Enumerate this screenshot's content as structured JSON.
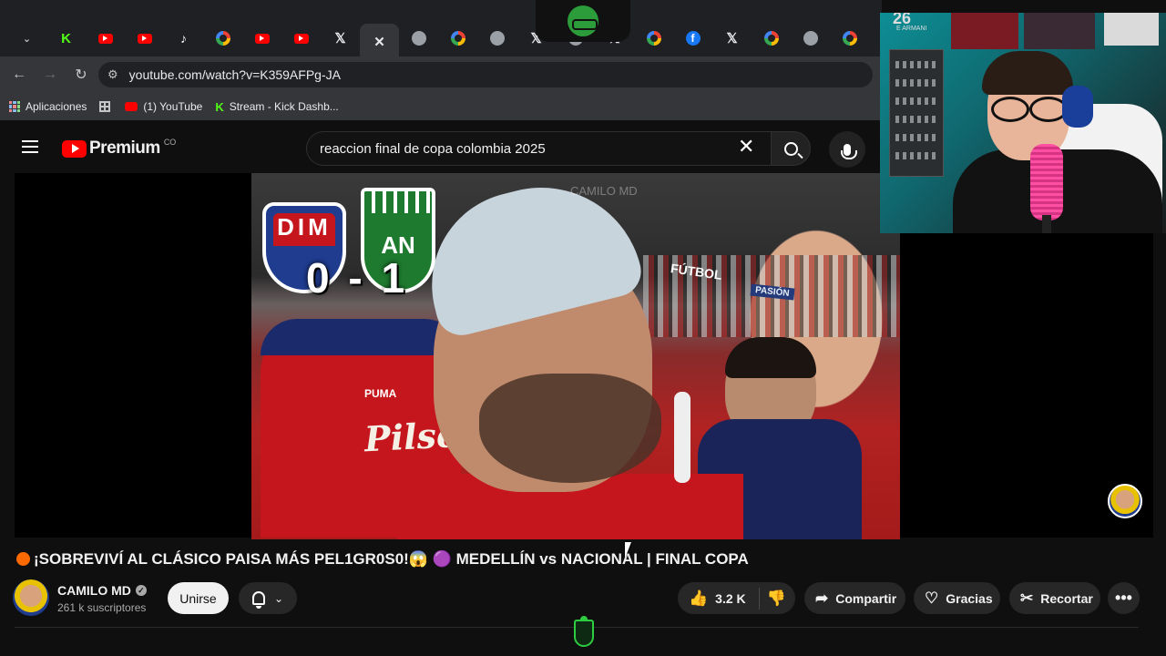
{
  "browser": {
    "tabs": [
      {
        "icon": "kick-icon",
        "glyph": "K",
        "cls": "k"
      },
      {
        "icon": "youtube-icon",
        "glyph": "",
        "cls": "yt"
      },
      {
        "icon": "youtube-icon",
        "glyph": "",
        "cls": "yt"
      },
      {
        "icon": "tiktok-icon",
        "glyph": "♪",
        "cls": "tt"
      },
      {
        "icon": "google-icon",
        "glyph": "",
        "cls": "g"
      },
      {
        "icon": "youtube-icon",
        "glyph": "",
        "cls": "yt"
      },
      {
        "icon": "youtube-icon",
        "glyph": "",
        "cls": "yt"
      },
      {
        "icon": "x-icon",
        "glyph": "𝕏",
        "cls": "x"
      },
      {
        "icon": "close-icon",
        "glyph": "✕",
        "cls": "x",
        "active": true
      },
      {
        "icon": "globe-icon",
        "glyph": "",
        "cls": "gl"
      },
      {
        "icon": "google-icon",
        "glyph": "",
        "cls": "g"
      },
      {
        "icon": "globe-icon",
        "glyph": "",
        "cls": "gl"
      },
      {
        "icon": "x-icon",
        "glyph": "𝕏",
        "cls": "x"
      },
      {
        "icon": "globe-icon",
        "glyph": "",
        "cls": "gl"
      },
      {
        "icon": "x-icon",
        "glyph": "𝕏",
        "cls": "x"
      },
      {
        "icon": "google-icon",
        "glyph": "",
        "cls": "g"
      },
      {
        "icon": "facebook-icon",
        "glyph": "f",
        "cls": "fb"
      },
      {
        "icon": "x-icon",
        "glyph": "𝕏",
        "cls": "x"
      },
      {
        "icon": "google-icon",
        "glyph": "",
        "cls": "g"
      },
      {
        "icon": "globe-icon",
        "glyph": "",
        "cls": "gl"
      },
      {
        "icon": "google-icon",
        "glyph": "",
        "cls": "g"
      }
    ],
    "url": "youtube.com/watch?v=K359AFPg-JA",
    "bookmarks": {
      "apps": "Aplicaciones",
      "youtube": "(1) YouTube",
      "kick": "Stream - Kick Dashb..."
    }
  },
  "youtube": {
    "logo_text": "Premium",
    "country_code": "CO",
    "search_value": "reaccion final de copa colombia 2025"
  },
  "video": {
    "overlay_score": "0 - 1",
    "crest_left": "DIM",
    "crest_right": "AN",
    "watermark": "CAMILO MD",
    "shirt_text": "Pilsen",
    "shirt_brand": "PUMA",
    "stadium_sign": "FÚTBOL",
    "stadium_sign2": "PASIÓN"
  },
  "webcam": {
    "poster_number": "26",
    "poster_name": "E ARMANI"
  },
  "meta": {
    "title": "¡SOBREVIVÍ AL CLÁSICO PAISA MÁS PEL1GR0S0!😱 🟣 MEDELLÍN vs NACIONAL | FINAL COPA",
    "channel": "CAMILO MD",
    "subscribers": "261 k suscriptores",
    "join": "Unirse",
    "likes": "3.2 K",
    "share": "Compartir",
    "thanks": "Gracias",
    "clip": "Recortar"
  }
}
